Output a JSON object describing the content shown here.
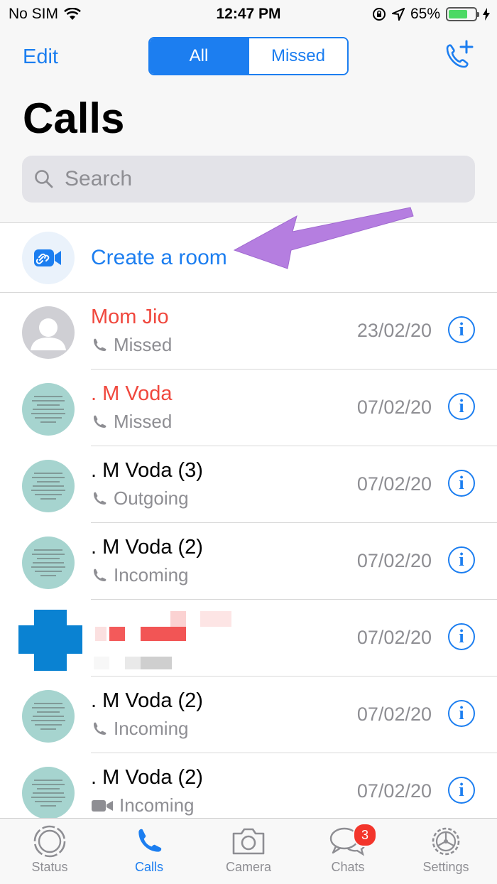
{
  "status": {
    "carrier": "No SIM",
    "time": "12:47 PM",
    "battery": "65%"
  },
  "nav": {
    "edit": "Edit",
    "seg_all": "All",
    "seg_missed": "Missed",
    "add_call_icon": "phone-plus-icon"
  },
  "title": "Calls",
  "search": {
    "placeholder": "Search"
  },
  "room": {
    "label": "Create a room",
    "icon": "link-video-icon"
  },
  "calls": [
    {
      "name": "Mom Jio",
      "type": "Missed",
      "date": "23/02/20",
      "missed": true,
      "avatar": "default"
    },
    {
      "name": ". M Voda",
      "type": "Missed",
      "date": "07/02/20",
      "missed": true,
      "avatar": "quote"
    },
    {
      "name": ". M Voda  (3)",
      "type": "Outgoing",
      "date": "07/02/20",
      "missed": false,
      "avatar": "quote"
    },
    {
      "name": ". M Voda  (2)",
      "type": "Incoming",
      "date": "07/02/20",
      "missed": false,
      "avatar": "quote"
    },
    {
      "name": "",
      "type": "",
      "date": "07/02/20",
      "missed": false,
      "avatar": "redacted"
    },
    {
      "name": ". M Voda  (2)",
      "type": "Incoming",
      "date": "07/02/20",
      "missed": false,
      "avatar": "quote"
    },
    {
      "name": ". M Voda  (2)",
      "type": "Incoming",
      "date": "07/02/20",
      "missed": false,
      "avatar": "quote",
      "call_kind": "video"
    }
  ],
  "tabs": [
    {
      "label": "Status",
      "icon": "status-ring-icon"
    },
    {
      "label": "Calls",
      "icon": "phone-icon",
      "active": true
    },
    {
      "label": "Camera",
      "icon": "camera-icon"
    },
    {
      "label": "Chats",
      "icon": "chat-bubbles-icon",
      "badge": "3"
    },
    {
      "label": "Settings",
      "icon": "gear-icon"
    }
  ],
  "colors": {
    "accent": "#1c7ef0",
    "missed": "#f0483e",
    "arrow": "#b57ee0",
    "badge": "#f3352b"
  }
}
